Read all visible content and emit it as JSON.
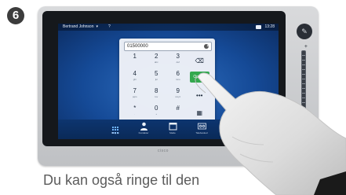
{
  "step_number": "6",
  "status_bar": {
    "user": "Bertrand Johnson",
    "user_menu_caret": "▾",
    "help": "?",
    "time": "13:28"
  },
  "dial": {
    "number": "01500000",
    "clear_icon": "✕",
    "keys": [
      {
        "digit": "1",
        "letters": ""
      },
      {
        "digit": "2",
        "letters": "abc"
      },
      {
        "digit": "3",
        "letters": "def"
      },
      {
        "digit": "4",
        "letters": "ghi"
      },
      {
        "digit": "5",
        "letters": "jkl"
      },
      {
        "digit": "6",
        "letters": "mno"
      },
      {
        "digit": "7",
        "letters": "pqrs"
      },
      {
        "digit": "8",
        "letters": "tuv"
      },
      {
        "digit": "9",
        "letters": "wxyz"
      },
      {
        "digit": "*",
        "letters": "."
      },
      {
        "digit": "0",
        "letters": "+"
      },
      {
        "digit": "#",
        "letters": ""
      }
    ],
    "backspace_icon": "⌫",
    "call_label": "Opkald",
    "more_icon": "•••",
    "keypad_toggle_icon": "▦"
  },
  "side_control": {
    "icon": "✎",
    "zoom_plus": "+"
  },
  "toolbar": {
    "keypad_label": "Ring op",
    "contacts_label": "Kontakter",
    "meet_label": "Møde",
    "voicemail_label": "Talebesked",
    "share_label": ""
  },
  "device_logo": "cisco",
  "caption": "Du kan også ringe til den",
  "colors": {
    "screen_blue": "#154a97",
    "call_green": "#33a84e",
    "frame": "#c9cbce"
  }
}
